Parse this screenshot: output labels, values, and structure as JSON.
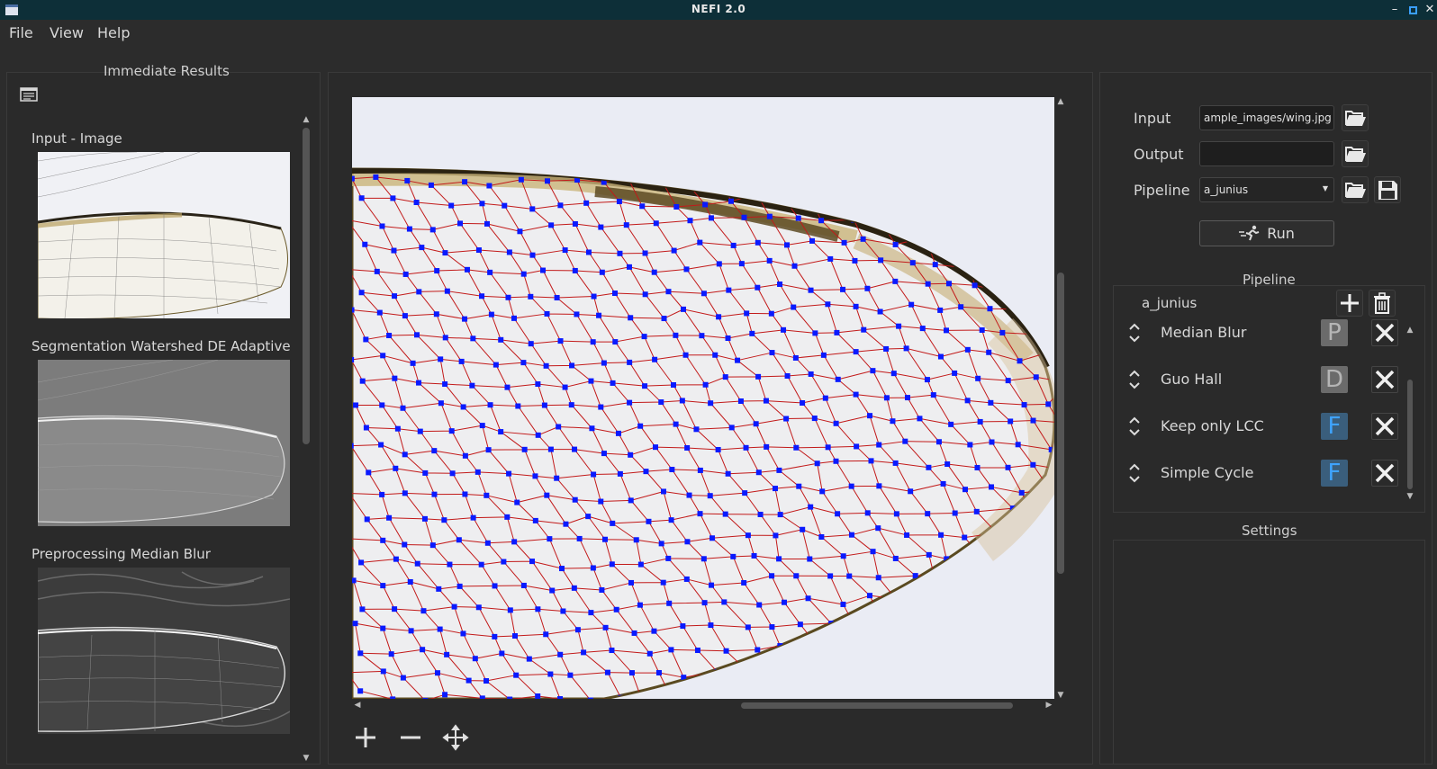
{
  "window": {
    "title": "NEFI 2.0"
  },
  "menu": {
    "file": "File",
    "view": "View",
    "help": "Help"
  },
  "left": {
    "title": "Immediate Results",
    "items": [
      {
        "label": "Input - Image"
      },
      {
        "label": "Segmentation Watershed DE Adaptive"
      },
      {
        "label": "Preprocessing Median Blur"
      }
    ]
  },
  "io": {
    "input_label": "Input",
    "input_value": "ample_images/wing.jpg",
    "output_label": "Output",
    "output_value": "",
    "pipeline_label": "Pipeline",
    "pipeline_value": "a_junius",
    "run_label": "Run"
  },
  "pipeline": {
    "title": "Pipeline",
    "name": "a_junius",
    "steps": [
      {
        "name": "Median Blur",
        "type": "P"
      },
      {
        "name": "Guo Hall",
        "type": "D"
      },
      {
        "name": "Keep only LCC",
        "type": "F"
      },
      {
        "name": "Simple Cycle",
        "type": "F"
      }
    ]
  },
  "settings": {
    "title": "Settings"
  },
  "colors": {
    "node": "#0a1aff",
    "edge": "#c21a1a",
    "wing_bg": "#eaecf4",
    "vein": "#6b5a2a"
  }
}
